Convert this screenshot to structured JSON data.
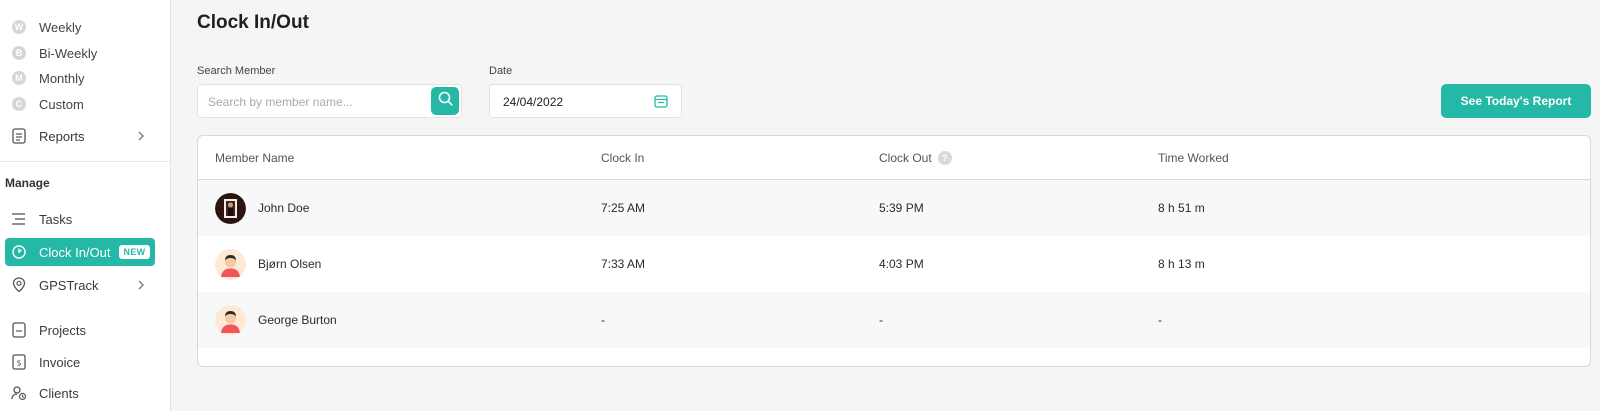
{
  "sidebar": {
    "sub_items": [
      {
        "letter": "W",
        "label": "Weekly"
      },
      {
        "letter": "B",
        "label": "Bi-Weekly"
      },
      {
        "letter": "M",
        "label": "Monthly"
      },
      {
        "letter": "C",
        "label": "Custom"
      }
    ],
    "reports_label": "Reports",
    "manage_label": "Manage",
    "tasks_label": "Tasks",
    "clock_label": "Clock In/Out",
    "clock_badge": "NEW",
    "gps_label": "GPSTrack",
    "projects_label": "Projects",
    "invoice_label": "Invoice",
    "clients_label": "Clients",
    "accent_color": "#26b8a6"
  },
  "main": {
    "title": "Clock In/Out",
    "search_label": "Search Member",
    "search_placeholder": "Search by member name...",
    "date_label": "Date",
    "date_value": "24/04/2022",
    "report_button": "See Today's Report"
  },
  "table": {
    "headers": {
      "member": "Member Name",
      "clock_in": "Clock In",
      "clock_out": "Clock Out",
      "help": "?",
      "time_worked": "Time Worked"
    },
    "rows": [
      {
        "name": "John Doe",
        "clock_in": "7:25 AM",
        "clock_out": "5:39 PM",
        "time_worked": "8 h 51 m"
      },
      {
        "name": "Bjørn Olsen",
        "clock_in": "7:33 AM",
        "clock_out": "4:03 PM",
        "time_worked": "8 h 13 m"
      },
      {
        "name": "George Burton",
        "clock_in": "-",
        "clock_out": "-",
        "time_worked": "-"
      }
    ]
  }
}
